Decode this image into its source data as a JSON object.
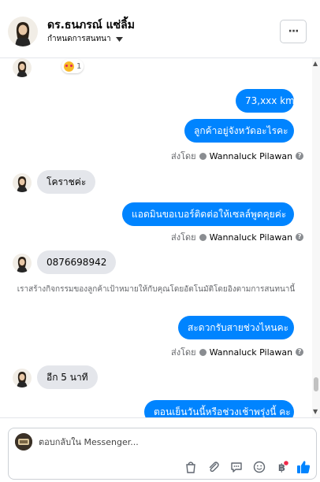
{
  "header": {
    "title": "ดร.ธนภรณ์ แซ่ลิ้ม",
    "subtitle": "กำหนดการสนทนา",
    "more_button": "···"
  },
  "reaction": {
    "count": "1"
  },
  "messages": [
    {
      "direction": "out",
      "text": "73,xxx km"
    },
    {
      "direction": "out",
      "text": "ลูกค้าอยู่จังหวัดอะไรคะ",
      "sent_by_label": "ส่งโดย",
      "sender": "Wannaluck Pilawan"
    },
    {
      "direction": "in",
      "text": "โคราชค่ะ"
    },
    {
      "direction": "out",
      "text": "แอดมินขอเบอร์ติดต่อให้เซลล์พูดคุยค่ะ",
      "sent_by_label": "ส่งโดย",
      "sender": "Wannaluck Pilawan"
    },
    {
      "direction": "in",
      "text": "0876698942"
    },
    {
      "direction": "system",
      "text": "เราสร้างกิจกรรมของลูกค้าเป้าหมายให้กับคุณโดยอัตโนมัติโดยอิงตามการสนทนานี้"
    },
    {
      "direction": "out",
      "text": "สะดวกรับสายช่วงไหนคะ",
      "sent_by_label": "ส่งโดย",
      "sender": "Wannaluck Pilawan"
    },
    {
      "direction": "in",
      "text": "อีก 5 นาที"
    },
    {
      "direction": "out",
      "text": "ตอนเย็นวันนี้หรือช่วงเช้าพรุ่งนี้ คะ"
    }
  ],
  "composer": {
    "placeholder": "ตอบกลับใน Messenger...",
    "tools": [
      "bag-icon",
      "paperclip-icon",
      "chat-bubble-icon",
      "emoji-icon",
      "baht-icon",
      "thumbs-up-icon"
    ]
  },
  "colors": {
    "outgoing": "#0084ff",
    "incoming": "#e4e6eb",
    "meta_text": "#65676b",
    "thumbs_up": "#0084ff"
  }
}
